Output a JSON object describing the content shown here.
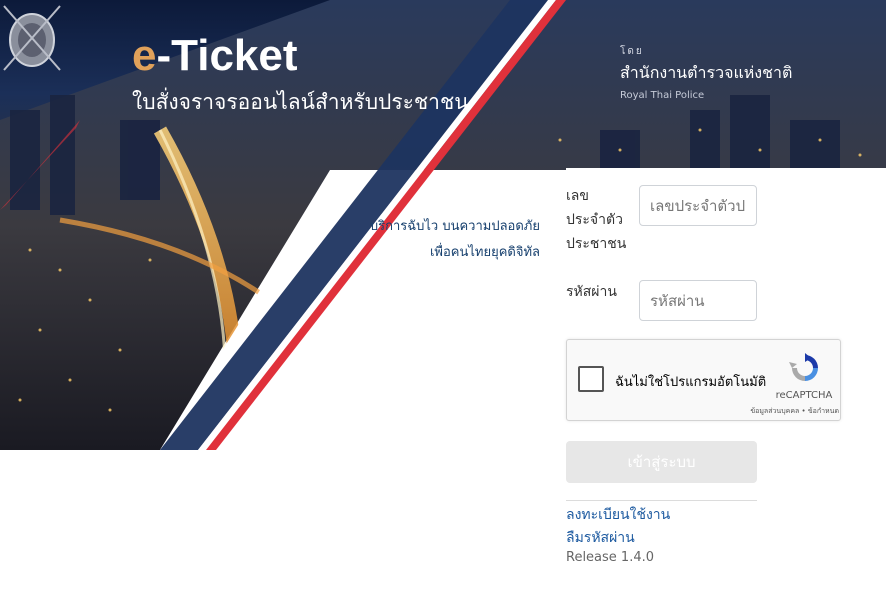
{
  "hero": {
    "title_e": "e",
    "title_rest": "-Ticket",
    "subtitle": "ใบสั่งจราจรออนไลน์สำหรับประชาชน",
    "tagline_line1": "บริการฉับไว บนความปลอดภัย",
    "tagline_line2": "เพื่อคนไทยยุคดิจิทัล"
  },
  "org": {
    "by": "โดย",
    "name_th": "สำนักงานตำรวจแห่งชาติ",
    "name_en": "Royal Thai Police"
  },
  "form": {
    "id_label_line1": "เลข",
    "id_label_line2": "ประจำตัว",
    "id_label_line3": "ประชาชน",
    "id_placeholder": "เลขประจำตัวประชาชน",
    "password_label": "รหัสผ่าน",
    "password_placeholder": "รหัสผ่าน",
    "captcha_label": "ฉันไม่ใช่โปรแกรมอัตโนมัติ",
    "captcha_brand": "reCAPTCHA",
    "captcha_terms": "ข้อมูลส่วนบุคคล • ข้อกำหนด",
    "login_button": "เข้าสู่ระบบ",
    "register_link": "ลงทะเบียนใช้งาน",
    "forgot_link": "ลืมรหัสผ่าน",
    "release": "Release 1.4.0"
  },
  "colors": {
    "navy": "#1e3460",
    "red_stripe": "#e0313b",
    "accent_orange": "#e0a15a",
    "link_blue": "#1d5aa0",
    "button_disabled": "#e7e7e7"
  }
}
